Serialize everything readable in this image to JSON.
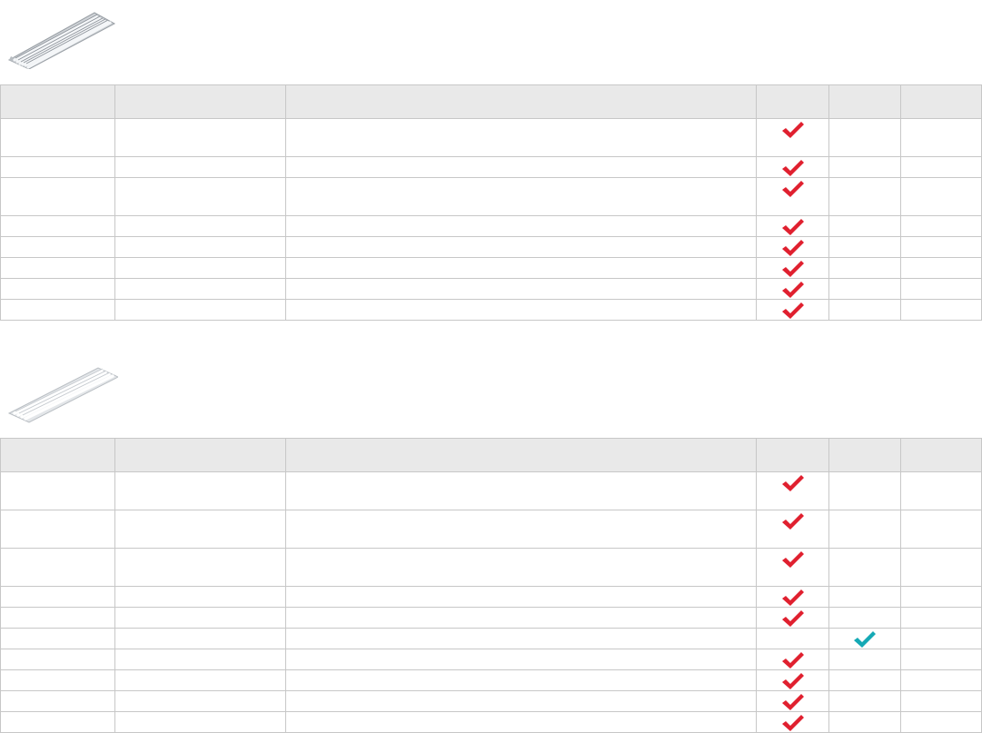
{
  "colors": {
    "header_bg": "#e9e9e9",
    "border": "#c7c7c7",
    "check_red": "#e0202f",
    "check_teal": "#15a9b5"
  },
  "tables": [
    {
      "image": "fluorescent-highbay-fixture-image",
      "columns": [
        "",
        "",
        "",
        "",
        "",
        ""
      ],
      "rows": [
        {
          "h": 42,
          "cells": [
            "",
            "",
            "",
            "",
            "",
            ""
          ],
          "checks": [
            "red-check-icon",
            "",
            ""
          ]
        },
        {
          "h": 22,
          "cells": [
            "",
            "",
            "",
            "",
            "",
            ""
          ],
          "checks": [
            "red-check-icon",
            "",
            ""
          ]
        },
        {
          "h": 42,
          "cells": [
            "",
            "",
            "",
            "",
            "",
            ""
          ],
          "checks": [
            "red-check-icon",
            "",
            ""
          ]
        },
        {
          "h": 22,
          "cells": [
            "",
            "",
            "",
            "",
            "",
            ""
          ],
          "checks": [
            "red-check-icon",
            "",
            ""
          ]
        },
        {
          "h": 22,
          "cells": [
            "",
            "",
            "",
            "",
            "",
            ""
          ],
          "checks": [
            "red-check-icon",
            "",
            ""
          ]
        },
        {
          "h": 22,
          "cells": [
            "",
            "",
            "",
            "",
            "",
            ""
          ],
          "checks": [
            "red-check-icon",
            "",
            ""
          ]
        },
        {
          "h": 22,
          "cells": [
            "",
            "",
            "",
            "",
            "",
            ""
          ],
          "checks": [
            "red-check-icon",
            "",
            ""
          ]
        },
        {
          "h": 22,
          "cells": [
            "",
            "",
            "",
            "",
            "",
            ""
          ],
          "checks": [
            "red-check-icon",
            "",
            ""
          ]
        }
      ]
    },
    {
      "image": "fluorescent-highbay-fixture-image",
      "columns": [
        "",
        "",
        "",
        "",
        "",
        ""
      ],
      "rows": [
        {
          "h": 42,
          "cells": [
            "",
            "",
            "",
            "",
            "",
            ""
          ],
          "checks": [
            "red-check-icon",
            "",
            ""
          ]
        },
        {
          "h": 42,
          "cells": [
            "",
            "",
            "",
            "",
            "",
            ""
          ],
          "checks": [
            "red-check-icon",
            "",
            ""
          ]
        },
        {
          "h": 42,
          "cells": [
            "",
            "",
            "",
            "",
            "",
            ""
          ],
          "checks": [
            "red-check-icon",
            "",
            ""
          ]
        },
        {
          "h": 22,
          "cells": [
            "",
            "",
            "",
            "",
            "",
            ""
          ],
          "checks": [
            "red-check-icon",
            "",
            ""
          ]
        },
        {
          "h": 22,
          "cells": [
            "",
            "",
            "",
            "",
            "",
            ""
          ],
          "checks": [
            "red-check-icon",
            "",
            ""
          ]
        },
        {
          "h": 22,
          "cells": [
            "",
            "",
            "",
            "",
            "",
            ""
          ],
          "checks": [
            "",
            "teal-check-icon",
            ""
          ]
        },
        {
          "h": 22,
          "cells": [
            "",
            "",
            "",
            "",
            "",
            ""
          ],
          "checks": [
            "red-check-icon",
            "",
            ""
          ]
        },
        {
          "h": 22,
          "cells": [
            "",
            "",
            "",
            "",
            "",
            ""
          ],
          "checks": [
            "red-check-icon",
            "",
            ""
          ]
        },
        {
          "h": 22,
          "cells": [
            "",
            "",
            "",
            "",
            "",
            ""
          ],
          "checks": [
            "red-check-icon",
            "",
            ""
          ]
        },
        {
          "h": 22,
          "cells": [
            "",
            "",
            "",
            "",
            "",
            ""
          ],
          "checks": [
            "red-check-icon",
            "",
            ""
          ]
        }
      ]
    }
  ]
}
